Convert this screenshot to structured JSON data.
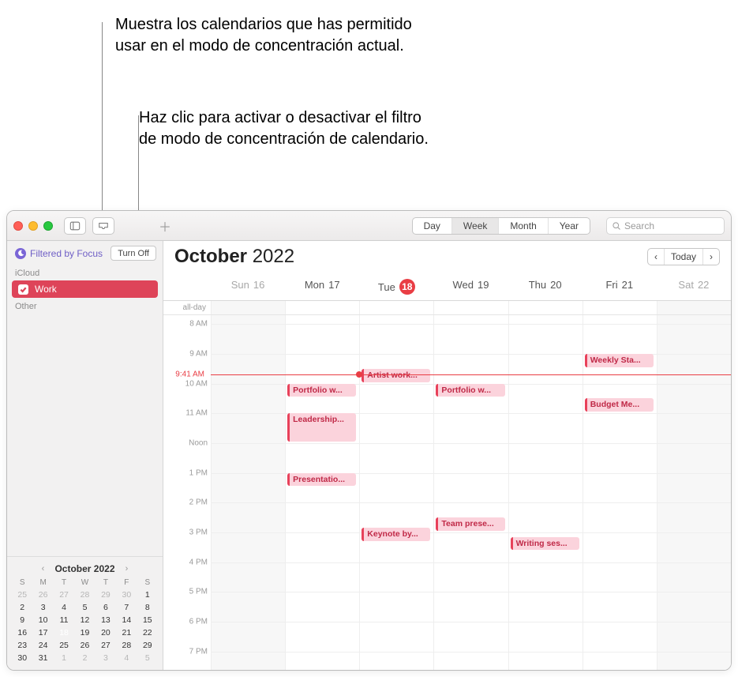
{
  "annotations": {
    "callout1": "Muestra los calendarios que has permitido usar en el modo de concentración actual.",
    "callout2": "Haz clic para activar o desactivar el filtro de modo de concentración de calendario."
  },
  "toolbar": {
    "view_segments": {
      "day": "Day",
      "week": "Week",
      "month": "Month",
      "year": "Year",
      "active": "Week"
    },
    "search_placeholder": "Search"
  },
  "sidebar": {
    "focus_label": "Filtered by Focus",
    "turn_off": "Turn Off",
    "icloud_label": "iCloud",
    "other_label": "Other",
    "calendars": [
      {
        "name": "Work",
        "color": "#de4459",
        "checked": true
      }
    ]
  },
  "mini_cal": {
    "title": "October 2022",
    "dow": [
      "S",
      "M",
      "T",
      "W",
      "T",
      "F",
      "S"
    ],
    "weeks": [
      [
        {
          "n": "25",
          "dim": true
        },
        {
          "n": "26",
          "dim": true
        },
        {
          "n": "27",
          "dim": true
        },
        {
          "n": "28",
          "dim": true
        },
        {
          "n": "29",
          "dim": true
        },
        {
          "n": "30",
          "dim": true
        },
        {
          "n": "1"
        }
      ],
      [
        {
          "n": "2"
        },
        {
          "n": "3"
        },
        {
          "n": "4"
        },
        {
          "n": "5"
        },
        {
          "n": "6"
        },
        {
          "n": "7"
        },
        {
          "n": "8"
        }
      ],
      [
        {
          "n": "9"
        },
        {
          "n": "10"
        },
        {
          "n": "11"
        },
        {
          "n": "12"
        },
        {
          "n": "13"
        },
        {
          "n": "14"
        },
        {
          "n": "15"
        }
      ],
      [
        {
          "n": "16"
        },
        {
          "n": "17"
        },
        {
          "n": "18",
          "today": true
        },
        {
          "n": "19"
        },
        {
          "n": "20"
        },
        {
          "n": "21"
        },
        {
          "n": "22"
        }
      ],
      [
        {
          "n": "23"
        },
        {
          "n": "24"
        },
        {
          "n": "25"
        },
        {
          "n": "26"
        },
        {
          "n": "27"
        },
        {
          "n": "28"
        },
        {
          "n": "29"
        }
      ],
      [
        {
          "n": "30"
        },
        {
          "n": "31"
        },
        {
          "n": "1",
          "dim": true
        },
        {
          "n": "2",
          "dim": true
        },
        {
          "n": "3",
          "dim": true
        },
        {
          "n": "4",
          "dim": true
        },
        {
          "n": "5",
          "dim": true
        }
      ]
    ]
  },
  "header": {
    "month": "October",
    "year": "2022",
    "today_btn": "Today"
  },
  "days": [
    {
      "label": "Sun",
      "num": "16",
      "weekend": true
    },
    {
      "label": "Mon",
      "num": "17"
    },
    {
      "label": "Tue",
      "num": "18",
      "today": true
    },
    {
      "label": "Wed",
      "num": "19"
    },
    {
      "label": "Thu",
      "num": "20"
    },
    {
      "label": "Fri",
      "num": "21"
    },
    {
      "label": "Sat",
      "num": "22",
      "weekend": true
    }
  ],
  "allday_label": "all-day",
  "hours": [
    {
      "h": 8,
      "label": "8 AM"
    },
    {
      "h": 9,
      "label": "9 AM"
    },
    {
      "h": 10,
      "label": "10 AM"
    },
    {
      "h": 11,
      "label": "11 AM"
    },
    {
      "h": 12,
      "label": "Noon"
    },
    {
      "h": 13,
      "label": "1 PM"
    },
    {
      "h": 14,
      "label": "2 PM"
    },
    {
      "h": 15,
      "label": "3 PM"
    },
    {
      "h": 16,
      "label": "4 PM"
    },
    {
      "h": 17,
      "label": "5 PM"
    },
    {
      "h": 18,
      "label": "6 PM"
    },
    {
      "h": 19,
      "label": "7 PM"
    }
  ],
  "now": {
    "label": "9:41 AM",
    "hour": 9.68,
    "dot_day": 2
  },
  "events": [
    {
      "day": 1,
      "start": 10,
      "end": 10.5,
      "title": "Portfolio w..."
    },
    {
      "day": 1,
      "start": 11,
      "end": 12,
      "title": "Leadership..."
    },
    {
      "day": 1,
      "start": 13,
      "end": 13.5,
      "title": "Presentatio..."
    },
    {
      "day": 2,
      "start": 9.5,
      "end": 10,
      "title": "Artist work..."
    },
    {
      "day": 2,
      "start": 14.85,
      "end": 15.35,
      "title": "Keynote by..."
    },
    {
      "day": 3,
      "start": 10,
      "end": 10.5,
      "title": "Portfolio w..."
    },
    {
      "day": 3,
      "start": 14.5,
      "end": 15,
      "title": "Team prese..."
    },
    {
      "day": 4,
      "start": 15.15,
      "end": 15.65,
      "title": "Writing ses..."
    },
    {
      "day": 5,
      "start": 9,
      "end": 9.5,
      "title": "Weekly Sta..."
    },
    {
      "day": 5,
      "start": 10.5,
      "end": 11,
      "title": "Budget Me..."
    }
  ]
}
